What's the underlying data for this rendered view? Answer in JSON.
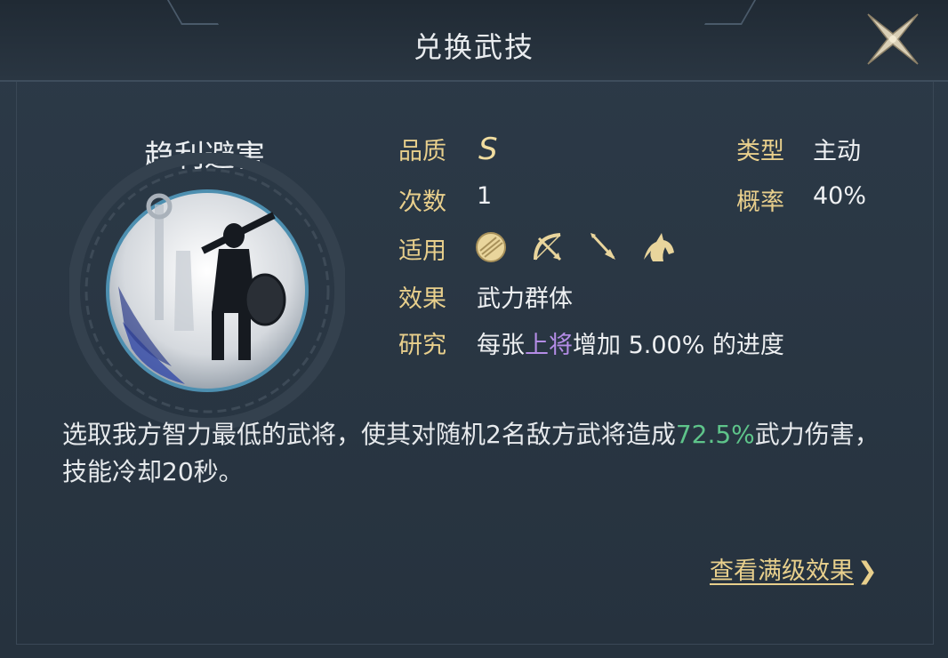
{
  "dialog": {
    "title": "兑换武技"
  },
  "skill": {
    "name": "趋利避害",
    "stats": {
      "quality_label": "品质",
      "quality_value": "S",
      "type_label": "类型",
      "type_value": "主动",
      "count_label": "次数",
      "count_value": "1",
      "rate_label": "概率",
      "rate_value": "40%",
      "apply_label": "适用",
      "apply_icons": [
        "shield-icon",
        "bow-icon",
        "spear-icon",
        "horse-icon"
      ],
      "effect_label": "效果",
      "effect_value": "武力群体",
      "research_label": "研究",
      "research_prefix": "每张",
      "research_highlight": "上将",
      "research_suffix": "增加 5.00% 的进度"
    },
    "description": {
      "part1": "选取我方智力最低的武将，使其对随机2名敌方武将造成",
      "highlight": "72.5%",
      "part2": "武力伤害，技能冷却20秒。"
    },
    "full_effect_link": "查看满级效果",
    "colors": {
      "label_gold": "#e8cf8c",
      "highlight_green": "#5ec48a",
      "highlight_purple": "#b48ce6"
    }
  }
}
